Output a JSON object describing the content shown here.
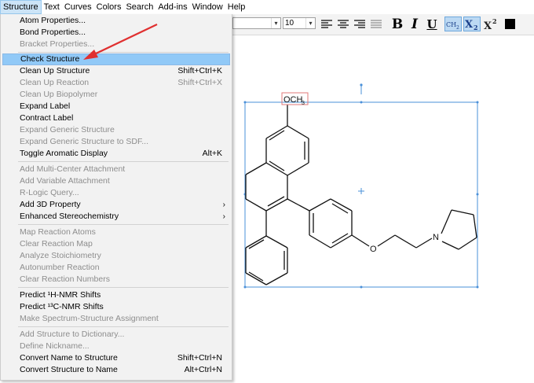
{
  "menubar": {
    "items": [
      "Structure",
      "Text",
      "Curves",
      "Colors",
      "Search",
      "Add-ins",
      "Window",
      "Help"
    ]
  },
  "toolbar": {
    "font_size_value": "10",
    "bold_label": "B",
    "italic_label": "I",
    "underline_label": "U",
    "formula_label": "CH2",
    "subscript_label": "X2",
    "superscript_label": "X2",
    "color_swatch": "#000000",
    "icons": [
      "align-left-icon",
      "align-center-icon",
      "align-right-icon",
      "justify-icon",
      "formula-icon",
      "subscript-icon",
      "superscript-icon",
      "color-icon"
    ]
  },
  "menu": {
    "items": [
      {
        "label": "Atom Properties...",
        "shortcut": "",
        "disabled": false
      },
      {
        "label": "Bond Properties...",
        "shortcut": "",
        "disabled": false
      },
      {
        "label": "Bracket Properties...",
        "shortcut": "",
        "disabled": true
      },
      {
        "label": "Check Structure",
        "shortcut": "",
        "disabled": false,
        "highlighted": true
      },
      {
        "label": "Clean Up Structure",
        "shortcut": "Shift+Ctrl+K",
        "disabled": false
      },
      {
        "label": "Clean Up Reaction",
        "shortcut": "Shift+Ctrl+X",
        "disabled": true
      },
      {
        "label": "Clean Up Biopolymer",
        "shortcut": "",
        "disabled": true
      },
      {
        "label": "Expand Label",
        "shortcut": "",
        "disabled": false
      },
      {
        "label": "Contract Label",
        "shortcut": "",
        "disabled": false
      },
      {
        "label": "Expand Generic Structure",
        "shortcut": "",
        "disabled": true
      },
      {
        "label": "Expand Generic Structure to SDF...",
        "shortcut": "",
        "disabled": true
      },
      {
        "label": "Toggle Aromatic Display",
        "shortcut": "Alt+K",
        "disabled": false
      },
      {
        "label": "Add Multi-Center Attachment",
        "shortcut": "",
        "disabled": true
      },
      {
        "label": "Add Variable Attachment",
        "shortcut": "",
        "disabled": true
      },
      {
        "label": "R-Logic Query...",
        "shortcut": "",
        "disabled": true
      },
      {
        "label": "Add 3D Property",
        "shortcut": "",
        "disabled": false,
        "submenu": true
      },
      {
        "label": "Enhanced Stereochemistry",
        "shortcut": "",
        "disabled": false,
        "submenu": true
      },
      {
        "label": "Map Reaction Atoms",
        "shortcut": "",
        "disabled": true
      },
      {
        "label": "Clear Reaction Map",
        "shortcut": "",
        "disabled": true
      },
      {
        "label": "Analyze Stoichiometry",
        "shortcut": "",
        "disabled": true
      },
      {
        "label": "Autonumber Reaction",
        "shortcut": "",
        "disabled": true
      },
      {
        "label": "Clear Reaction Numbers",
        "shortcut": "",
        "disabled": true
      },
      {
        "label": "Predict ¹H-NMR Shifts",
        "shortcut": "",
        "disabled": false
      },
      {
        "label": "Predict ¹³C-NMR Shifts",
        "shortcut": "",
        "disabled": false
      },
      {
        "label": "Make Spectrum-Structure Assignment",
        "shortcut": "",
        "disabled": true
      },
      {
        "label": "Add Structure to Dictionary...",
        "shortcut": "",
        "disabled": true
      },
      {
        "label": "Define Nickname...",
        "shortcut": "",
        "disabled": true
      },
      {
        "label": "Convert Name to Structure",
        "shortcut": "Shift+Ctrl+N",
        "disabled": false
      },
      {
        "label": "Convert Structure to Name",
        "shortcut": "Alt+Ctrl+N",
        "disabled": false
      }
    ],
    "submenu_glyph": "›"
  },
  "canvas": {
    "atom_labels": {
      "och3": "OCH",
      "och3_sub": "3",
      "oxygen": "O",
      "nitrogen": "N"
    },
    "selection_color": "#4a90d9",
    "annotation_color": "#e03030"
  }
}
